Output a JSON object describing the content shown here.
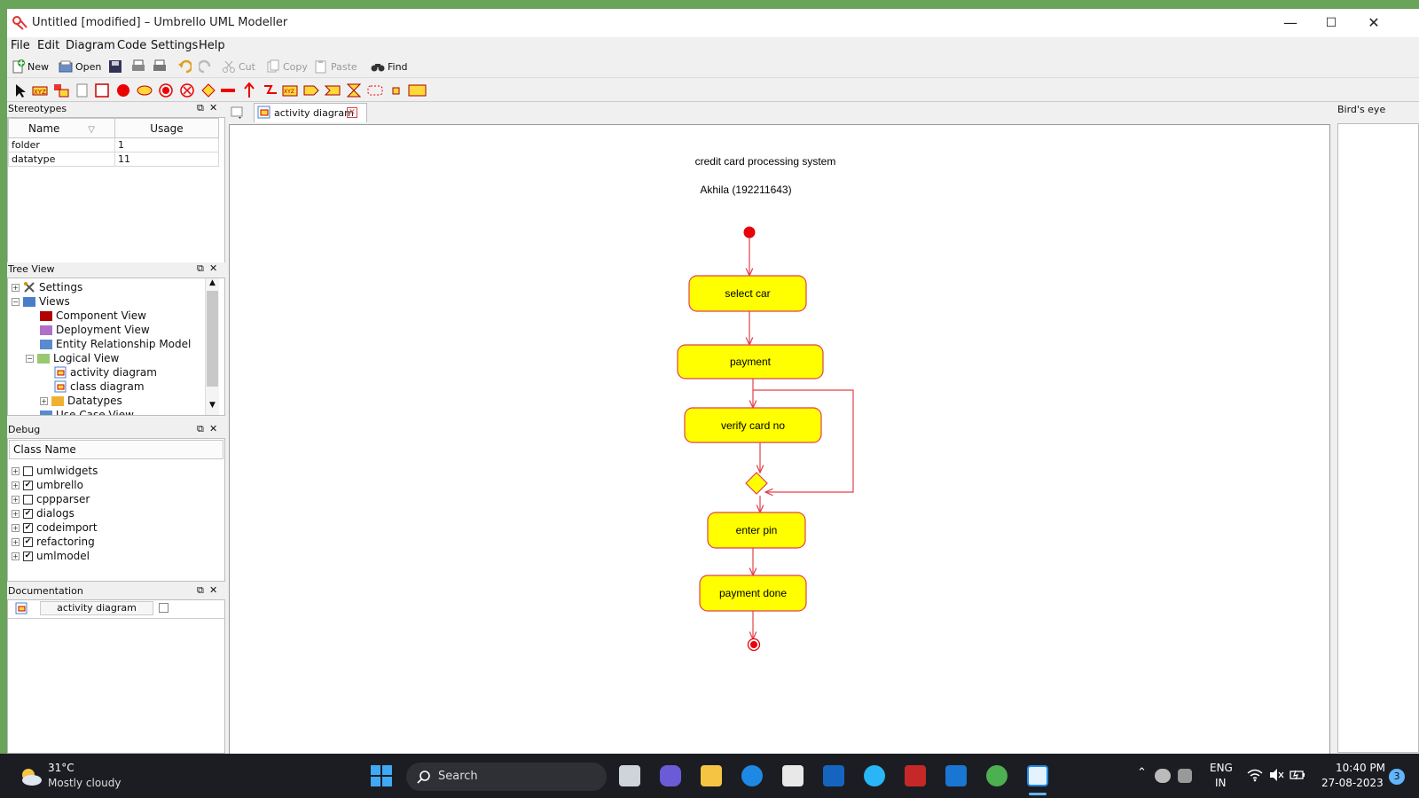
{
  "window": {
    "title": "Untitled [modified] – Umbrello UML Modeller",
    "minimize": "—",
    "maximize": "☐",
    "close": "✕"
  },
  "menu": [
    "File",
    "Edit",
    "Diagram",
    "Code",
    "Settings",
    "Help"
  ],
  "toolbar": {
    "new": "New",
    "open": "Open",
    "cut": "Cut",
    "copy": "Copy",
    "paste": "Paste",
    "find": "Find"
  },
  "stereotypes": {
    "title": "Stereotypes",
    "columns": [
      "Name",
      "Usage"
    ],
    "rows": [
      {
        "name": "folder",
        "usage": "1"
      },
      {
        "name": "datatype",
        "usage": "11"
      }
    ]
  },
  "tree_view": {
    "title": "Tree View",
    "items": [
      {
        "label": "Settings"
      },
      {
        "label": "Views"
      },
      {
        "label": "Component View"
      },
      {
        "label": "Deployment View"
      },
      {
        "label": "Entity Relationship Model"
      },
      {
        "label": "Logical View"
      },
      {
        "label": "activity diagram"
      },
      {
        "label": "class diagram"
      },
      {
        "label": "Datatypes"
      },
      {
        "label": "Use Case View"
      }
    ]
  },
  "debug": {
    "title": "Debug",
    "column": "Class Name",
    "items": [
      {
        "label": "umlwidgets",
        "checked": false
      },
      {
        "label": "umbrello",
        "checked": true
      },
      {
        "label": "cppparser",
        "checked": false
      },
      {
        "label": "dialogs",
        "checked": true
      },
      {
        "label": "codeimport",
        "checked": true
      },
      {
        "label": "refactoring",
        "checked": true
      },
      {
        "label": "umlmodel",
        "checked": true
      }
    ]
  },
  "documentation": {
    "title": "Documentation",
    "item": "activity diagram"
  },
  "tab": {
    "label": "activity diagram"
  },
  "birds_eye": {
    "title": "Bird's eye"
  },
  "diagram": {
    "title": "credit card processing system",
    "author": "Akhila (192211643)",
    "activities": [
      "select car",
      "payment",
      "verify card no",
      "enter pin",
      "payment done"
    ],
    "colors": {
      "fill": "#ffff00",
      "stroke": "#e8000b",
      "line": "#e0424c"
    }
  },
  "taskbar": {
    "weather_temp": "31°C",
    "weather_desc": "Mostly cloudy",
    "search": "Search",
    "lang1": "ENG",
    "lang2": "IN",
    "time": "10:40 PM",
    "date": "27-08-2023",
    "notif_count": "3"
  }
}
